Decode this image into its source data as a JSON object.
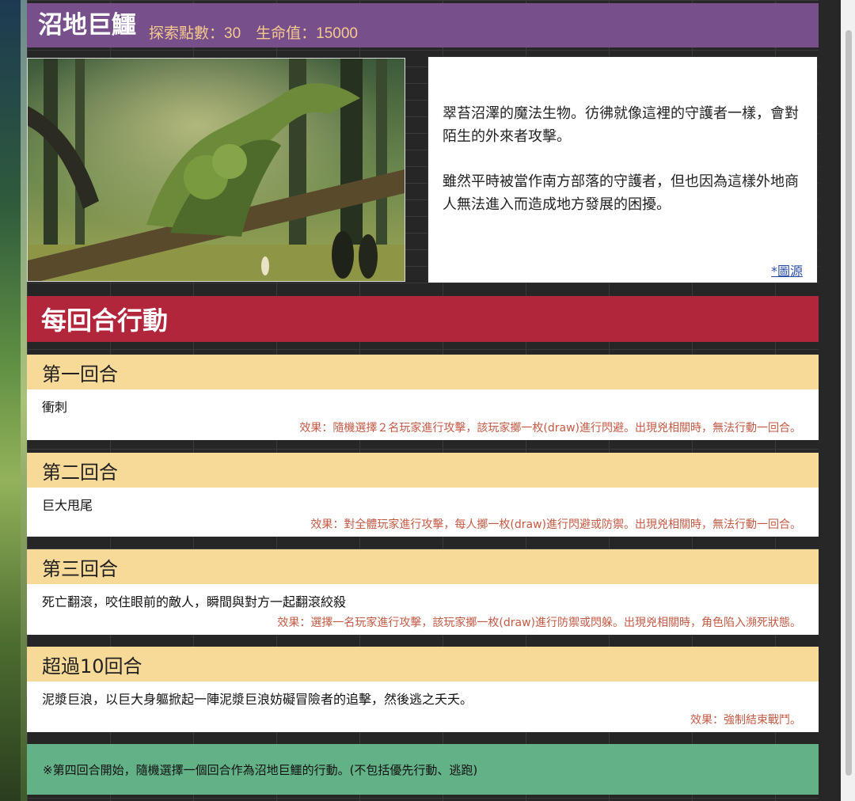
{
  "header": {
    "title": "沼地巨鱷",
    "stats": "探索點數：30　生命值：15000"
  },
  "hero_image": {
    "subject": "swamp-crocodile-illustration"
  },
  "description": {
    "paragraph1": "翠苔沼澤的魔法生物。彷彿就像這裡的守護者一樣，會對陌生的外來者攻擊。",
    "paragraph2": "雖然平時被當作南方部落的守護者，但也因為這樣外地商人無法進入而造成地方發展的困擾。",
    "source_link": "*圖源"
  },
  "section": {
    "title": "每回合行動"
  },
  "rounds": [
    {
      "heading": "第一回合",
      "name": "衝刺",
      "effect": "效果：隨機選擇２名玩家進行攻擊，該玩家擲一枚(draw)進行閃避。出現兇相關時，無法行動一回合。"
    },
    {
      "heading": "第二回合",
      "name": "巨大甩尾",
      "effect": "效果：對全體玩家進行攻擊，每人擲一枚(draw)進行閃避或防禦。出現兇相關時，無法行動一回合。"
    },
    {
      "heading": "第三回合",
      "name": "死亡翻滾，咬住眼前的敵人，瞬間與對方一起翻滾絞殺",
      "effect": "效果：選擇一名玩家進行攻擊，該玩家擲一枚(draw)進行防禦或閃躲。出現兇相關時，角色陷入瀕死狀態。"
    },
    {
      "heading": "超過10回合",
      "name": "泥漿巨浪，以巨大身軀掀起一陣泥漿巨浪妨礙冒險者的追擊，然後逃之夭夭。",
      "effect": "效果：強制結束戰鬥。"
    }
  ],
  "note": "※第四回合開始，隨機選擇一個回合作為沼地巨鱷的行動。(不包括優先行動、逃跑)",
  "colors": {
    "title_bar": "#764f8b",
    "section_bar": "#b1263b",
    "round_header": "#f8da98",
    "effect_text": "#c35a45",
    "note_box": "#63b187"
  }
}
